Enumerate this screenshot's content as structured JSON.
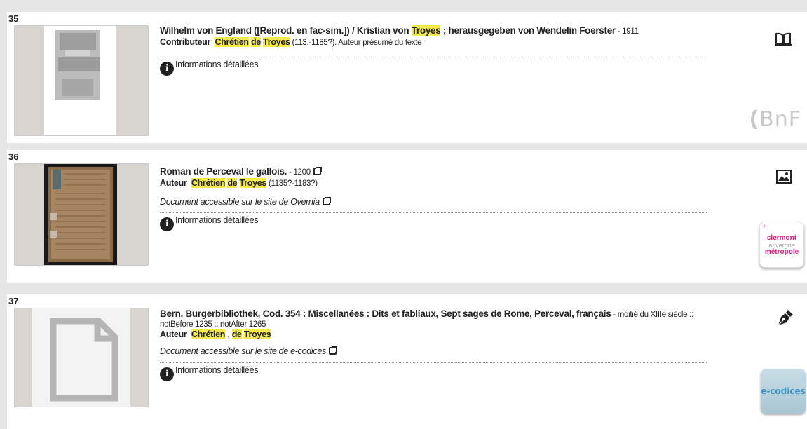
{
  "results": [
    {
      "number": "35",
      "title": "Wilhelm von England ([Reprod. en fac-sim.]) / Kristian von ",
      "title_hl": "Troyes",
      "title_rest": " ; herausgegeben von Wendelin Foerster",
      "date": " - 1911",
      "role": "Contributeur",
      "name_a": "Chrétien",
      "name_b": "de",
      "name_c": "Troyes",
      "name_suffix": " (113.-1185?). Auteur présumé du texte",
      "info_label": "Informations détaillées",
      "type_icon": "book-icon",
      "source_logo": "BnF"
    },
    {
      "number": "36",
      "title": "Roman de Perceval le gallois.",
      "date": " - 1200",
      "role": "Auteur",
      "name_a": "Chrétien",
      "name_b": "de",
      "name_c": "Troyes",
      "name_suffix": " (1135?-1183?)",
      "access": "Document accessible sur le site de Overnia",
      "info_label": "Informations détaillées",
      "type_icon": "image-icon",
      "source_logo_lines": [
        "clermont",
        "auvergne",
        "métropole"
      ]
    },
    {
      "number": "37",
      "title": "Bern, Burgerbibliothek, Cod. 354 : Miscellanées : Dits et fabliaux, Sept sages de Rome, Perceval, français",
      "date_inline": " - moitié du XIIIe siècle ::",
      "date_line2": "notBefore 1235 :: notAfter 1265",
      "role": "Auteur",
      "name_a": "Chrétien",
      "name_sep": " , ",
      "name_b": "de",
      "name_c": "Troyes",
      "access": "Document accessible sur le site de e-codices",
      "info_label": "Informations détaillées",
      "type_icon": "pen-icon",
      "source_logo": "e-codices"
    }
  ],
  "colors": {
    "highlight": "#f5e94a",
    "bnf_gray": "#c8c8c8",
    "clermont_pink": "#e0157a"
  }
}
